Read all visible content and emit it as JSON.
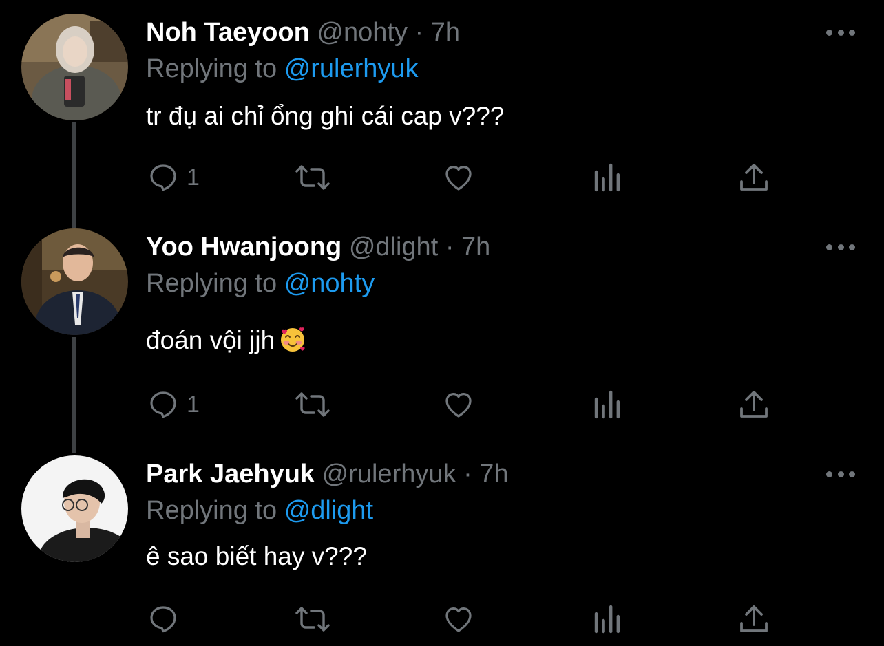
{
  "tweets": [
    {
      "display_name": "Noh Taeyoon",
      "handle": "@nohty",
      "separator": "·",
      "time": "7h",
      "replying_prefix": "Replying to",
      "replying_to": "@rulerhyuk",
      "text": "tr đụ ai chỉ ổng ghi cái cap v???",
      "reply_count": "1"
    },
    {
      "display_name": "Yoo Hwanjoong",
      "handle": "@dlight",
      "separator": "·",
      "time": "7h",
      "replying_prefix": "Replying to",
      "replying_to": "@nohty",
      "text": "đoán vội jjh",
      "emoji": "smiling-face-with-hearts",
      "reply_count": "1"
    },
    {
      "display_name": "Park Jaehyuk",
      "handle": "@rulerhyuk",
      "separator": "·",
      "time": "7h",
      "replying_prefix": "Replying to",
      "replying_to": "@dlight",
      "text": "ê sao biết hay v???",
      "reply_count": ""
    }
  ],
  "icons": {
    "reply": "reply-icon",
    "retweet": "retweet-icon",
    "like": "heart-icon",
    "analytics": "analytics-icon",
    "share": "share-icon",
    "more": "more-icon"
  },
  "colors": {
    "background": "#000000",
    "primary_text": "#ffffff",
    "secondary_text": "#71767b",
    "link": "#1d9bf0",
    "thread_line": "#3e4144"
  }
}
